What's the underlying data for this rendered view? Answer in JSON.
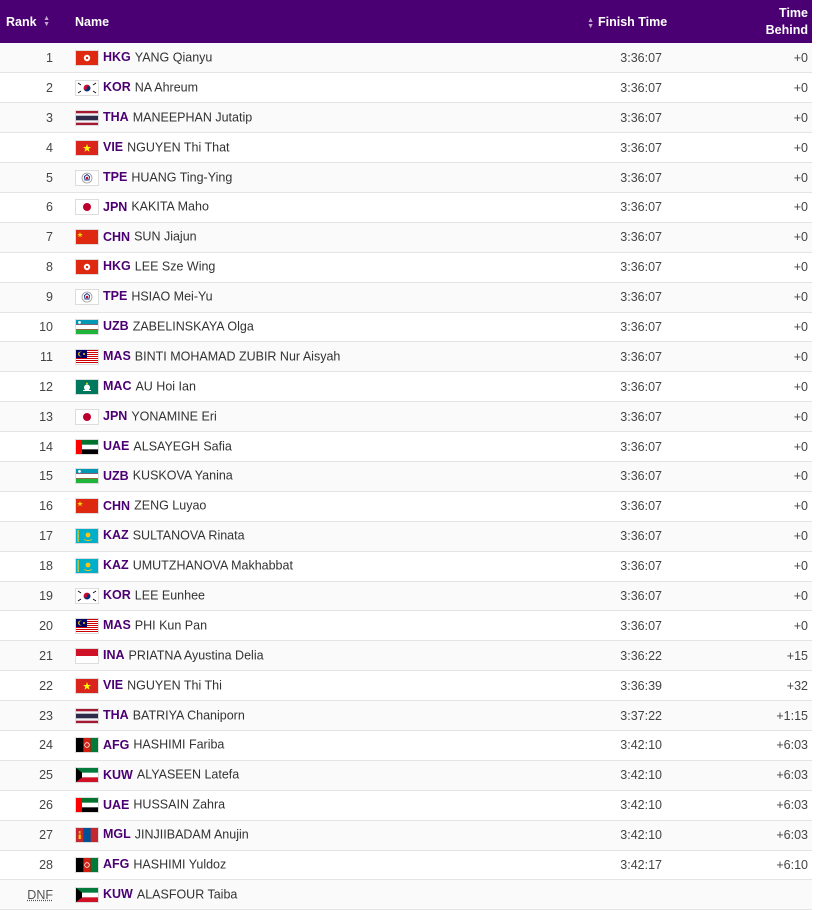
{
  "headers": {
    "rank": "Rank",
    "name": "Name",
    "finish": "Finish Time",
    "behind_1": "Time",
    "behind_2": "Behind"
  },
  "rows": [
    {
      "rank": "1",
      "code": "HKG",
      "name": "YANG Qianyu",
      "time": "3:36:07",
      "behind": "+0"
    },
    {
      "rank": "2",
      "code": "KOR",
      "name": "NA Ahreum",
      "time": "3:36:07",
      "behind": "+0"
    },
    {
      "rank": "3",
      "code": "THA",
      "name": "MANEEPHAN Jutatip",
      "time": "3:36:07",
      "behind": "+0"
    },
    {
      "rank": "4",
      "code": "VIE",
      "name": "NGUYEN Thi That",
      "time": "3:36:07",
      "behind": "+0"
    },
    {
      "rank": "5",
      "code": "TPE",
      "name": "HUANG Ting-Ying",
      "time": "3:36:07",
      "behind": "+0"
    },
    {
      "rank": "6",
      "code": "JPN",
      "name": "KAKITA Maho",
      "time": "3:36:07",
      "behind": "+0"
    },
    {
      "rank": "7",
      "code": "CHN",
      "name": "SUN Jiajun",
      "time": "3:36:07",
      "behind": "+0"
    },
    {
      "rank": "8",
      "code": "HKG",
      "name": "LEE Sze Wing",
      "time": "3:36:07",
      "behind": "+0"
    },
    {
      "rank": "9",
      "code": "TPE",
      "name": "HSIAO Mei-Yu",
      "time": "3:36:07",
      "behind": "+0"
    },
    {
      "rank": "10",
      "code": "UZB",
      "name": "ZABELINSKAYA Olga",
      "time": "3:36:07",
      "behind": "+0"
    },
    {
      "rank": "11",
      "code": "MAS",
      "name": "BINTI MOHAMAD ZUBIR Nur Aisyah",
      "time": "3:36:07",
      "behind": "+0"
    },
    {
      "rank": "12",
      "code": "MAC",
      "name": "AU Hoi Ian",
      "time": "3:36:07",
      "behind": "+0"
    },
    {
      "rank": "13",
      "code": "JPN",
      "name": "YONAMINE Eri",
      "time": "3:36:07",
      "behind": "+0"
    },
    {
      "rank": "14",
      "code": "UAE",
      "name": "ALSAYEGH Safia",
      "time": "3:36:07",
      "behind": "+0"
    },
    {
      "rank": "15",
      "code": "UZB",
      "name": "KUSKOVA Yanina",
      "time": "3:36:07",
      "behind": "+0"
    },
    {
      "rank": "16",
      "code": "CHN",
      "name": "ZENG Luyao",
      "time": "3:36:07",
      "behind": "+0"
    },
    {
      "rank": "17",
      "code": "KAZ",
      "name": "SULTANOVA Rinata",
      "time": "3:36:07",
      "behind": "+0"
    },
    {
      "rank": "18",
      "code": "KAZ",
      "name": "UMUTZHANOVA Makhabbat",
      "time": "3:36:07",
      "behind": "+0"
    },
    {
      "rank": "19",
      "code": "KOR",
      "name": "LEE Eunhee",
      "time": "3:36:07",
      "behind": "+0"
    },
    {
      "rank": "20",
      "code": "MAS",
      "name": "PHI Kun Pan",
      "time": "3:36:07",
      "behind": "+0"
    },
    {
      "rank": "21",
      "code": "INA",
      "name": "PRIATNA Ayustina Delia",
      "time": "3:36:22",
      "behind": "+15"
    },
    {
      "rank": "22",
      "code": "VIE",
      "name": "NGUYEN Thi Thi",
      "time": "3:36:39",
      "behind": "+32"
    },
    {
      "rank": "23",
      "code": "THA",
      "name": "BATRIYA Chaniporn",
      "time": "3:37:22",
      "behind": "+1:15"
    },
    {
      "rank": "24",
      "code": "AFG",
      "name": "HASHIMI Fariba",
      "time": "3:42:10",
      "behind": "+6:03"
    },
    {
      "rank": "25",
      "code": "KUW",
      "name": "ALYASEEN Latefa",
      "time": "3:42:10",
      "behind": "+6:03"
    },
    {
      "rank": "26",
      "code": "UAE",
      "name": "HUSSAIN Zahra",
      "time": "3:42:10",
      "behind": "+6:03"
    },
    {
      "rank": "27",
      "code": "MGL",
      "name": "JINJIIBADAM Anujin",
      "time": "3:42:10",
      "behind": "+6:03"
    },
    {
      "rank": "28",
      "code": "AFG",
      "name": "HASHIMI Yuldoz",
      "time": "3:42:17",
      "behind": "+6:10"
    },
    {
      "rank": "DNF",
      "code": "KUW",
      "name": "ALASFOUR Taiba",
      "time": "",
      "behind": ""
    }
  ],
  "colors": {
    "header_bg": "#4a0072",
    "country_code": "#4a0072"
  }
}
